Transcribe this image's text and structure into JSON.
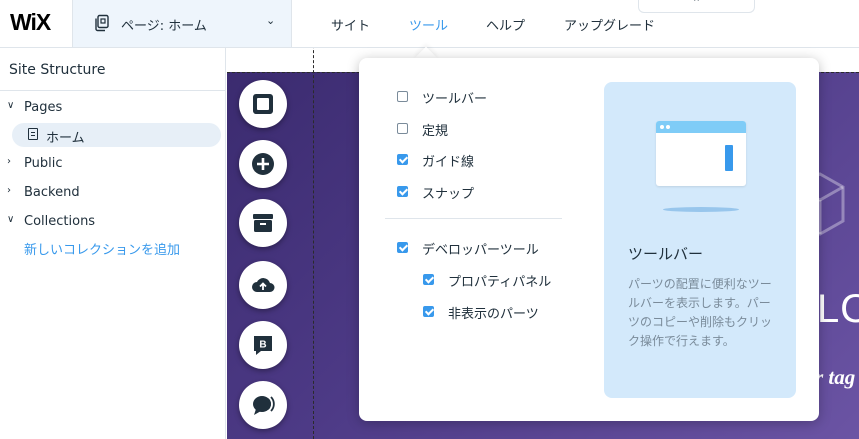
{
  "header": {
    "logo": "WiX",
    "page_selector": {
      "label": "ページ: ホーム"
    },
    "menu": [
      {
        "label": "サイト",
        "active": false
      },
      {
        "label": "ツール",
        "active": true
      },
      {
        "label": "ヘルプ",
        "active": false
      },
      {
        "label": "アップグレード",
        "active": false
      }
    ]
  },
  "site_structure": {
    "title": "Site Structure",
    "items": [
      {
        "label": "Pages",
        "expanded": true
      },
      {
        "label": "ホーム",
        "selected": true
      },
      {
        "label": "Public",
        "expanded": false
      },
      {
        "label": "Backend",
        "expanded": false
      },
      {
        "label": "Collections",
        "expanded": true
      }
    ],
    "add_collection": "新しいコレクションを追加"
  },
  "canvas": {
    "text_fragment": "LO",
    "italic_fragment": "r tag"
  },
  "add_tools": [
    {
      "name": "add-elements-square-icon"
    },
    {
      "name": "add-plus-icon"
    },
    {
      "name": "app-market-store-icon"
    },
    {
      "name": "upload-media-cloud-icon"
    },
    {
      "name": "blog-b-icon"
    },
    {
      "name": "chat-bubble-icon"
    }
  ],
  "tools_menu": {
    "options": [
      {
        "label": "ツールバー",
        "checked": false
      },
      {
        "label": "定規",
        "checked": false
      },
      {
        "label": "ガイド線",
        "checked": true
      },
      {
        "label": "スナップ",
        "checked": true
      },
      {
        "label": "デベロッパーツール",
        "checked": true
      },
      {
        "label": "プロパティパネル",
        "checked": true
      },
      {
        "label": "非表示のパーツ",
        "checked": true
      }
    ],
    "preview": {
      "title": "ツールバー",
      "description": "パーツの配置に便利なツールバーを表示します。パーツのコピーや削除もクリック操作で行えます。"
    }
  },
  "colors": {
    "accent": "#3899ec",
    "text": "#20303c",
    "preview_bg": "#d3e9fb",
    "canvas_bg": "#4d3a86"
  }
}
